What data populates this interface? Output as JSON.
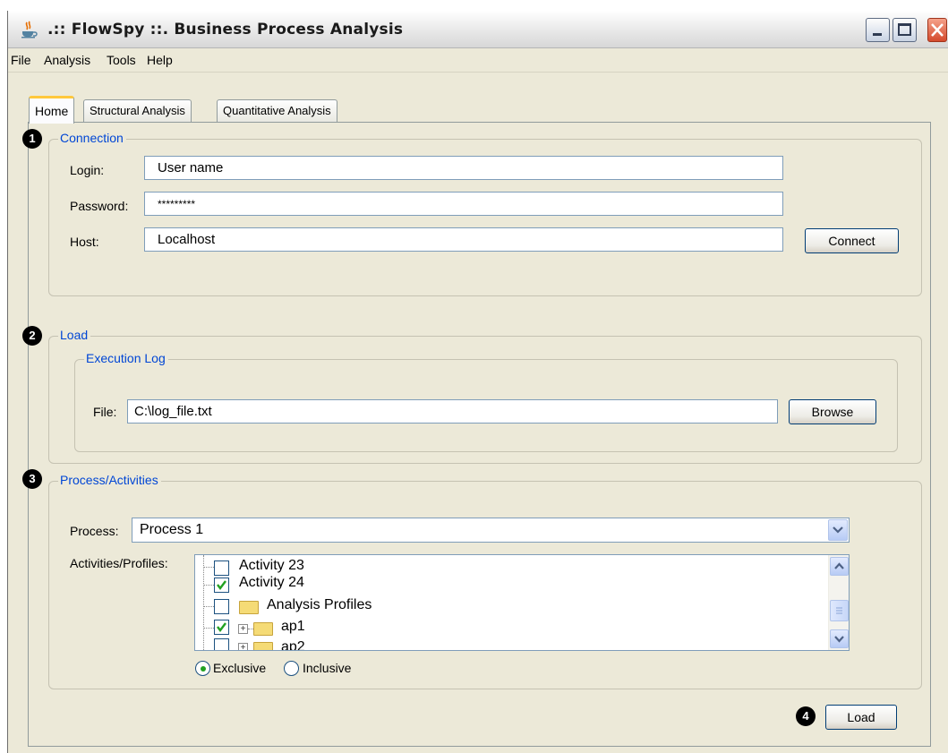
{
  "window": {
    "title": ".:: FlowSpy ::. Business Process Analysis",
    "icons": {
      "app": "java-coffee-cup-icon",
      "minimize": "minimize-icon",
      "maximize": "maximize-icon",
      "close": "close-icon"
    }
  },
  "menu": [
    "File",
    "Analysis",
    "Tools",
    "Help"
  ],
  "tabs": [
    {
      "label": "Home",
      "active": true
    },
    {
      "label": "Structural Analysis",
      "active": false
    },
    {
      "label": "Quantitative Analysis",
      "active": false
    }
  ],
  "steps": [
    "1",
    "2",
    "3",
    "4"
  ],
  "connection": {
    "legend": "Connection",
    "login_label": "Login:",
    "login_value": "User name",
    "password_label": "Password:",
    "password_value": "*********",
    "host_label": "Host:",
    "host_value": "Localhost",
    "connect_label": "Connect"
  },
  "load": {
    "legend": "Load",
    "execution_log_legend": "Execution Log",
    "file_label": "File:",
    "file_value": "C:\\log_file.txt",
    "browse_label": "Browse"
  },
  "process": {
    "legend": "Process/Activities",
    "process_label": "Process:",
    "process_value": "Process 1",
    "activities_label": "Activities/Profiles:",
    "tree": [
      {
        "label": "Activity 23",
        "checked": false,
        "type": "leaf"
      },
      {
        "label": "Activity 24",
        "checked": true,
        "type": "leaf"
      },
      {
        "label": "Analysis Profiles",
        "checked": false,
        "type": "folder"
      },
      {
        "label": "ap1",
        "checked": true,
        "type": "folder-expandable"
      },
      {
        "label": "ap2",
        "checked": false,
        "type": "folder-expandable"
      }
    ],
    "mode_options": [
      {
        "label": "Exclusive",
        "selected": true
      },
      {
        "label": "Inclusive",
        "selected": false
      }
    ]
  },
  "load_button_label": "Load",
  "colors": {
    "legend_text": "#0046d5",
    "checkmark": "#21a121",
    "active_tab_accent": "#ffc83c"
  }
}
